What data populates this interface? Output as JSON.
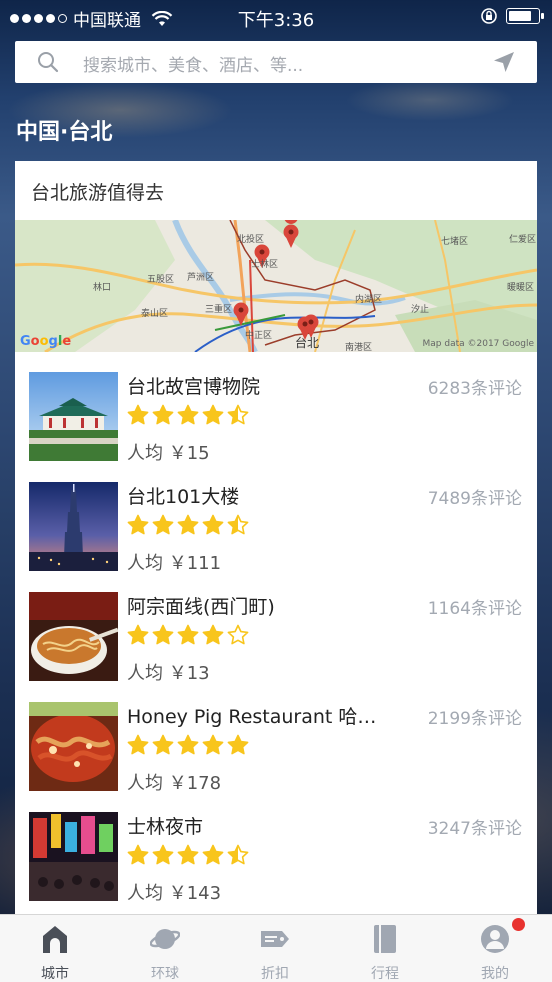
{
  "status_bar": {
    "carrier": "中国联通",
    "time": "下午3:36",
    "battery_level": 0.8
  },
  "search": {
    "placeholder": "搜索城市、美食、酒店、等..."
  },
  "city": {
    "title": "中国·台北"
  },
  "card": {
    "title": "台北旅游值得去",
    "map": {
      "labels": [
        "北投区",
        "士林区",
        "五股区",
        "芦洲区",
        "林口",
        "泰山区",
        "三重区",
        "中正区",
        "内湖区",
        "汐止",
        "七堵区",
        "仁爱区",
        "暖暖区",
        "南港区",
        "台北"
      ],
      "credit": "Map data ©2017 Google",
      "logo": "Google"
    },
    "items": [
      {
        "name": "台北故宫博物院",
        "reviews": "6283条评论",
        "rating": 4.5,
        "price": "人均 ￥15"
      },
      {
        "name": "台北101大楼",
        "reviews": "7489条评论",
        "rating": 4.5,
        "price": "人均 ￥111"
      },
      {
        "name": "阿宗面线(西门町)",
        "reviews": "1164条评论",
        "rating": 4,
        "price": "人均 ￥13"
      },
      {
        "name": "Honey Pig Restaurant 哈…",
        "reviews": "2199条评论",
        "rating": 5,
        "price": "人均 ￥178"
      },
      {
        "name": "士林夜市",
        "reviews": "3247条评论",
        "rating": 4.5,
        "price": "人均 ￥143"
      }
    ]
  },
  "tabs": [
    {
      "label": "城市",
      "icon": "city-home-icon",
      "active": true
    },
    {
      "label": "环球",
      "icon": "planet-icon",
      "active": false
    },
    {
      "label": "折扣",
      "icon": "discount-tag-icon",
      "active": false
    },
    {
      "label": "行程",
      "icon": "itinerary-book-icon",
      "active": false
    },
    {
      "label": "我的",
      "icon": "profile-icon",
      "active": false,
      "badge": true
    }
  ],
  "colors": {
    "star": "#f8c51c",
    "star_empty": "#f8c51c",
    "review_text": "#a3a9b2",
    "badge": "#e8322f",
    "map_pin": "#d9463b"
  }
}
